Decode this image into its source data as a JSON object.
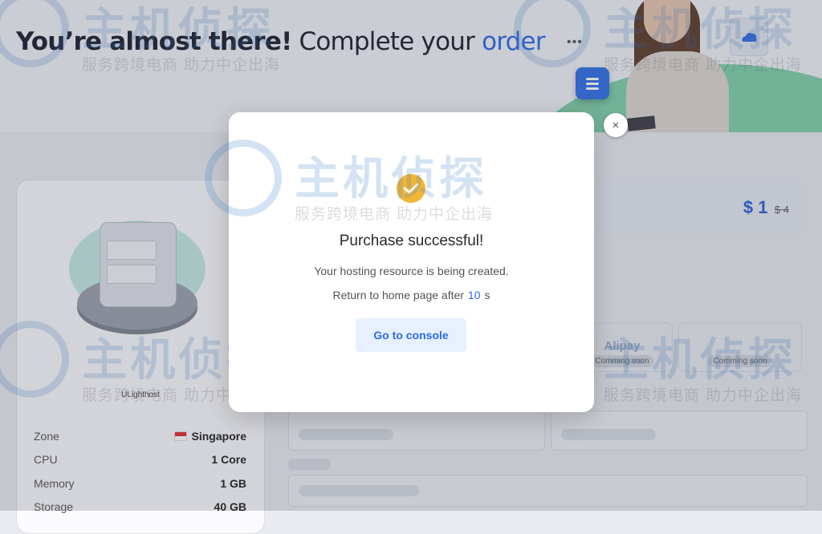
{
  "header": {
    "headline_bold": "You’re almost there!",
    "headline_normal": "Complete your",
    "headline_accent": "order"
  },
  "watermark": {
    "brand": "主机侦探",
    "tagline": "服务跨境电商 助力中企出海"
  },
  "server": {
    "name": "ULighthost",
    "specs": [
      {
        "key": "Zone",
        "value": "Singapore"
      },
      {
        "key": "CPU",
        "value": "1 Core"
      },
      {
        "key": "Memory",
        "value": "1 GB"
      },
      {
        "key": "Storage",
        "value": "40 GB"
      }
    ]
  },
  "price": {
    "current": "$ 1",
    "original": "$ 4"
  },
  "payment": {
    "alipay_label": "Alipay",
    "coming_soon_1": "Comming soon",
    "coming_soon_2": "Comming soon"
  },
  "modal": {
    "title": "Purchase successful!",
    "description": "Your hosting resource is being created.",
    "timer_prefix": "Return to home page after",
    "timer_value": "10",
    "timer_suffix": "s",
    "button_label": "Go to console",
    "close_label": "×"
  },
  "colors": {
    "accent": "#2b6be6",
    "success_icon": "#f2b636",
    "menu_button": "#2f6fe4"
  }
}
